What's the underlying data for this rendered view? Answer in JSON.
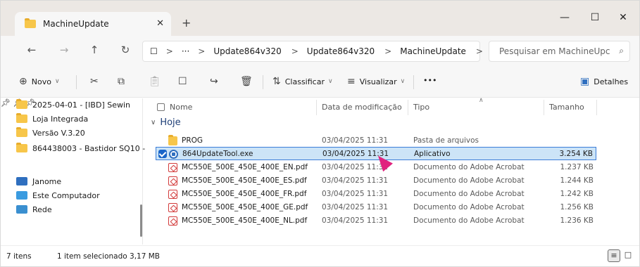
{
  "window": {
    "tab_title": "MachineUpdate",
    "tab_close": "✕",
    "new_tab": "+",
    "minimize": "—",
    "maximize": "☐",
    "close": "✕"
  },
  "nav": {
    "back": "←",
    "forward": "→",
    "up": "↑",
    "refresh": "↻",
    "view_icon": "☐",
    "more": "···"
  },
  "address": {
    "segments": [
      "Update864v320",
      "Update864v320",
      "MachineUpdate"
    ],
    "separator": ">"
  },
  "search": {
    "placeholder": "Pesquisar em MachineUpc",
    "icon": "search-icon"
  },
  "toolbar": {
    "new_label": "Novo",
    "sort_label": "Classificar",
    "view_label": "Visualizar",
    "more_label": "•••",
    "details_label": "Detalhes"
  },
  "sidebar": {
    "items": [
      {
        "label": "2025-04-01 - [IBD] Sewin",
        "icon": "folder-icon",
        "pinned": true
      },
      {
        "label": "Loja Integrada",
        "icon": "folder-icon",
        "pinned": true
      },
      {
        "label": "Versão V.3.20",
        "icon": "folder-icon",
        "pinned": true
      },
      {
        "label": "864438003 - Bastidor SQ10 -",
        "icon": "folder-icon",
        "pinned": false
      },
      {
        "label": "Janome",
        "icon": "library-icon",
        "pinned": false
      },
      {
        "label": "Este Computador",
        "icon": "computer-icon",
        "pinned": false
      },
      {
        "label": "Rede",
        "icon": "network-icon",
        "pinned": false
      }
    ]
  },
  "columns": {
    "name": "Nome",
    "modified": "Data de modificação",
    "type": "Tipo",
    "size": "Tamanho"
  },
  "group_label": "Hoje",
  "files": [
    {
      "name": "PROG",
      "modified": "03/04/2025 11:31",
      "type": "Pasta de arquivos",
      "size": "",
      "icon": "folder-icon"
    },
    {
      "name": "864UpdateTool.exe",
      "modified": "03/04/2025 11:31",
      "type": "Aplicativo",
      "size": "3.254 KB",
      "icon": "application-icon",
      "selected": true
    },
    {
      "name": "MC550E_500E_450E_400E_EN.pdf",
      "modified": "03/04/2025 11:31",
      "type": "Documento do Adobe Acrobat",
      "size": "1.237 KB",
      "icon": "pdf-icon"
    },
    {
      "name": "MC550E_500E_450E_400E_ES.pdf",
      "modified": "03/04/2025 11:31",
      "type": "Documento do Adobe Acrobat",
      "size": "1.244 KB",
      "icon": "pdf-icon"
    },
    {
      "name": "MC550E_500E_450E_400E_FR.pdf",
      "modified": "03/04/2025 11:31",
      "type": "Documento do Adobe Acrobat",
      "size": "1.242 KB",
      "icon": "pdf-icon"
    },
    {
      "name": "MC550E_500E_450E_400E_GE.pdf",
      "modified": "03/04/2025 11:31",
      "type": "Documento do Adobe Acrobat",
      "size": "1.256 KB",
      "icon": "pdf-icon"
    },
    {
      "name": "MC550E_500E_450E_400E_NL.pdf",
      "modified": "03/04/2025 11:31",
      "type": "Documento do Adobe Acrobat",
      "size": "1.236 KB",
      "icon": "pdf-icon"
    }
  ],
  "status": {
    "item_count": "7 itens",
    "selection": "1 item selecionado  3,17 MB"
  }
}
